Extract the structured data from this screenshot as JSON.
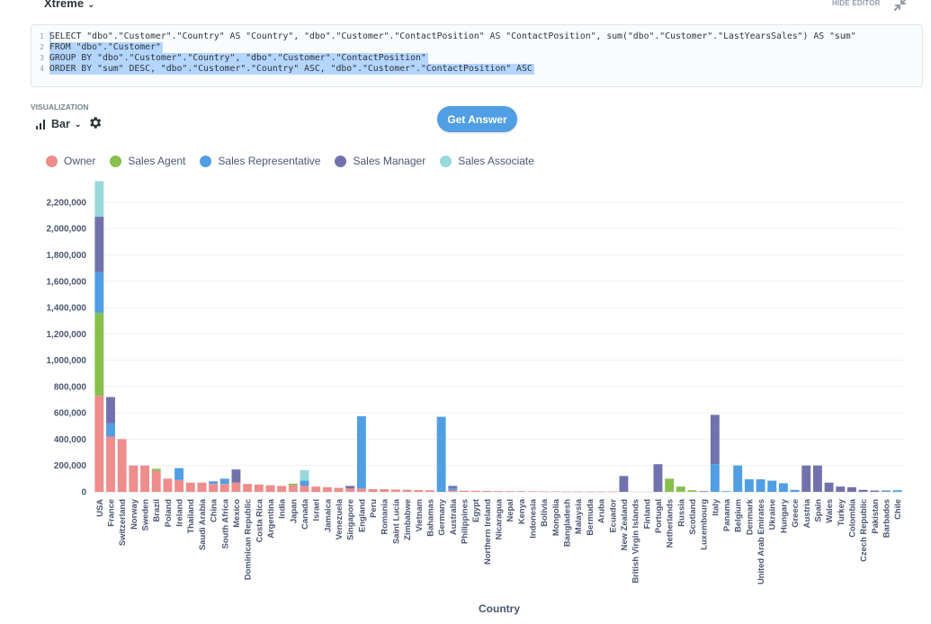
{
  "header": {
    "database": "Xtreme",
    "hide_editor": "HIDE EDITOR"
  },
  "editor": {
    "lines": [
      {
        "num": "1",
        "text": "SELECT \"dbo\".\"Customer\".\"Country\" AS \"Country\", \"dbo\".\"Customer\".\"ContactPosition\" AS \"ContactPosition\", sum(\"dbo\".\"Customer\".\"LastYearsSales\") AS \"sum\""
      },
      {
        "num": "2",
        "text": "FROM \"dbo\".\"Customer\""
      },
      {
        "num": "3",
        "text": "GROUP BY \"dbo\".\"Customer\".\"Country\", \"dbo\".\"Customer\".\"ContactPosition\""
      },
      {
        "num": "4",
        "text": "ORDER BY \"sum\" DESC, \"dbo\".\"Customer\".\"Country\" ASC, \"dbo\".\"Customer\".\"ContactPosition\" ASC"
      }
    ]
  },
  "visualization": {
    "label": "VISUALIZATION",
    "type_label": "Bar"
  },
  "get_answer_label": "Get Answer",
  "colors": {
    "accent": "#509ee3"
  },
  "chart_data": {
    "type": "bar",
    "stacked": true,
    "xlabel": "Country",
    "ylabel": "",
    "ylim": [
      0,
      2350000
    ],
    "ytick_values": [
      0,
      200000,
      400000,
      600000,
      800000,
      1000000,
      1200000,
      1400000,
      1600000,
      1800000,
      2000000,
      2200000
    ],
    "yticks": [
      "0",
      "200,000",
      "400,000",
      "600,000",
      "800,000",
      "1,000,000",
      "1,200,000",
      "1,400,000",
      "1,600,000",
      "1,800,000",
      "2,000,000",
      "2,200,000"
    ],
    "legend_position": "top-left",
    "grid": true,
    "categories": [
      "USA",
      "France",
      "Switzerland",
      "Norway",
      "Sweden",
      "Brazil",
      "Poland",
      "Ireland",
      "Thailand",
      "Saudi Arabia",
      "China",
      "South Africa",
      "Mexico",
      "Dominican Republic",
      "Costa Rica",
      "Argentina",
      "India",
      "Japan",
      "Canada",
      "Israel",
      "Jamaica",
      "Venezuela",
      "Singapore",
      "England",
      "Peru",
      "Romania",
      "Saint Lucia",
      "Zimbabwe",
      "Vietnam",
      "Bahamas",
      "Germany",
      "Australia",
      "Philippines",
      "Egypt",
      "Northern Ireland",
      "Nicaragua",
      "Nepal",
      "Kenya",
      "Indonesia",
      "Bolivia",
      "Mongolia",
      "Bangladesh",
      "Malaysia",
      "Bermuda",
      "Aruba",
      "Ecuador",
      "New Zealand",
      "British Virgin Islands",
      "Finland",
      "Portugal",
      "Netherlands",
      "Russia",
      "Scotland",
      "Luxembourg",
      "Italy",
      "Panama",
      "Belgium",
      "Denmark",
      "United Arab Emirates",
      "Ukraine",
      "Hungary",
      "Greece",
      "Austria",
      "Spain",
      "Wales",
      "Turkey",
      "Colombia",
      "Czech Republic",
      "Pakistan",
      "Barbados",
      "Chile"
    ],
    "series": [
      {
        "name": "Owner",
        "color": "#ef8c8c",
        "values": [
          730000,
          420000,
          400000,
          200000,
          200000,
          160000,
          100000,
          90000,
          70000,
          70000,
          60000,
          60000,
          70000,
          60000,
          55000,
          50000,
          45000,
          50000,
          45000,
          40000,
          35000,
          30000,
          25000,
          25000,
          20000,
          20000,
          18000,
          16000,
          14000,
          12000,
          0,
          10000,
          9000,
          8000,
          7000,
          6000,
          5000,
          5000,
          4000,
          4000,
          3500,
          3000,
          3000,
          2500,
          2000,
          2000,
          0,
          0,
          0,
          0,
          0,
          0,
          0,
          0,
          0,
          0,
          0,
          0,
          0,
          0,
          0,
          0,
          0,
          0,
          0,
          0,
          0,
          0,
          0,
          0,
          0
        ]
      },
      {
        "name": "Sales Agent",
        "color": "#88bf4d",
        "values": [
          630000,
          0,
          0,
          0,
          0,
          15000,
          0,
          0,
          0,
          0,
          0,
          0,
          0,
          0,
          0,
          0,
          0,
          12000,
          0,
          0,
          0,
          0,
          0,
          0,
          0,
          0,
          0,
          0,
          0,
          0,
          0,
          0,
          0,
          0,
          0,
          0,
          0,
          0,
          0,
          0,
          0,
          0,
          0,
          0,
          0,
          0,
          0,
          0,
          0,
          0,
          100000,
          40000,
          12000,
          0,
          0,
          0,
          0,
          0,
          0,
          0,
          0,
          0,
          0,
          0,
          0,
          0,
          0,
          0,
          0,
          0,
          0
        ]
      },
      {
        "name": "Sales Representative",
        "color": "#509ee3",
        "values": [
          310000,
          100000,
          0,
          0,
          0,
          0,
          0,
          90000,
          0,
          0,
          20000,
          40000,
          0,
          0,
          0,
          0,
          0,
          0,
          40000,
          0,
          0,
          0,
          0,
          550000,
          0,
          0,
          0,
          0,
          0,
          0,
          570000,
          15000,
          0,
          0,
          0,
          0,
          0,
          0,
          0,
          0,
          0,
          0,
          0,
          0,
          0,
          0,
          0,
          0,
          0,
          0,
          0,
          0,
          0,
          0,
          210000,
          5000,
          200000,
          95000,
          95000,
          85000,
          65000,
          15000,
          0,
          0,
          0,
          0,
          0,
          0,
          0,
          5000,
          10000
        ]
      },
      {
        "name": "Sales Manager",
        "color": "#7172ad",
        "values": [
          420000,
          200000,
          0,
          0,
          0,
          0,
          0,
          0,
          0,
          0,
          0,
          0,
          100000,
          0,
          0,
          0,
          0,
          0,
          0,
          0,
          0,
          0,
          20000,
          0,
          0,
          0,
          0,
          0,
          0,
          0,
          0,
          20000,
          0,
          0,
          0,
          0,
          0,
          0,
          0,
          0,
          0,
          0,
          0,
          0,
          0,
          0,
          120000,
          0,
          0,
          210000,
          0,
          0,
          0,
          5000,
          375000,
          0,
          0,
          0,
          0,
          0,
          0,
          0,
          200000,
          200000,
          70000,
          40000,
          35000,
          15000,
          10000,
          5000,
          0
        ]
      },
      {
        "name": "Sales Associate",
        "color": "#98d9d9",
        "values": [
          270000,
          0,
          0,
          0,
          0,
          0,
          0,
          0,
          0,
          0,
          0,
          0,
          0,
          0,
          0,
          0,
          0,
          0,
          80000,
          0,
          0,
          0,
          0,
          0,
          0,
          0,
          0,
          0,
          0,
          0,
          0,
          0,
          0,
          0,
          0,
          0,
          0,
          0,
          0,
          0,
          0,
          0,
          0,
          0,
          0,
          0,
          0,
          0,
          0,
          0,
          0,
          0,
          0,
          0,
          0,
          0,
          0,
          0,
          0,
          0,
          0,
          0,
          0,
          0,
          0,
          0,
          0,
          0,
          0,
          0,
          5000
        ]
      }
    ]
  }
}
